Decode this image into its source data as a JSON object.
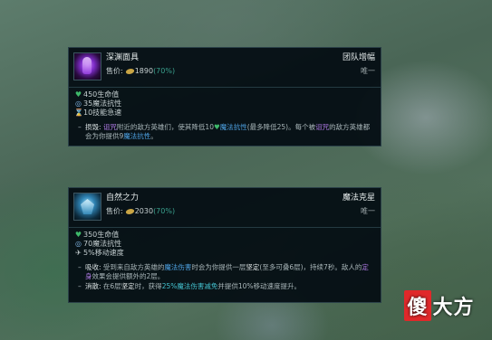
{
  "watermark": {
    "first": "傻",
    "rest": "大方"
  },
  "items": [
    {
      "name": "深渊面具",
      "category": "团队增幅",
      "price_label": "售价:",
      "cost": "1890",
      "sell": "(70%)",
      "unique": "唯一",
      "icon": "abyssal-mask-icon",
      "stats": [
        {
          "icon": "heart-icon",
          "glyph": "♥",
          "text": "450生命值"
        },
        {
          "icon": "magic-resist-icon",
          "glyph": "◎",
          "text": "35魔法抗性"
        },
        {
          "icon": "ability-haste-icon",
          "glyph": "⌛",
          "text": "10技能急速"
        }
      ],
      "passives": [
        {
          "name": "损毁:",
          "parts": [
            {
              "t": " "
            },
            {
              "t": "诅咒",
              "c": "purple"
            },
            {
              "t": "附近的敌方英雄们，使其降低10"
            },
            {
              "t": "♥",
              "c": "heart"
            },
            {
              "t": "魔法抗性",
              "c": "blue"
            },
            {
              "t": "(最多降低25)。每个被"
            },
            {
              "t": "诅咒",
              "c": "purple"
            },
            {
              "t": "的敌方英雄都会为你提供9"
            },
            {
              "t": "魔法抗性",
              "c": "blue"
            },
            {
              "t": "。"
            }
          ]
        }
      ]
    },
    {
      "name": "自然之力",
      "category": "魔法克星",
      "price_label": "售价:",
      "cost": "2030",
      "sell": "(70%)",
      "unique": "唯一",
      "icon": "force-of-nature-icon",
      "stats": [
        {
          "icon": "heart-icon",
          "glyph": "♥",
          "text": "350生命值"
        },
        {
          "icon": "magic-resist-icon",
          "glyph": "◎",
          "text": "70魔法抗性"
        },
        {
          "icon": "move-speed-icon",
          "glyph": "✈",
          "text": "5%移动速度"
        }
      ],
      "passives": [
        {
          "name": "吸收:",
          "parts": [
            {
              "t": " 受到来自敌方英雄的"
            },
            {
              "t": "魔法伤害",
              "c": "blue"
            },
            {
              "t": "时会为你提供一层"
            },
            {
              "t": "坚定",
              "c": "white"
            },
            {
              "t": "(至多可叠6层)，持续7秒。敌人的"
            },
            {
              "t": "定身",
              "c": "purple"
            },
            {
              "t": "效果会提供额外的2层。"
            }
          ]
        },
        {
          "name": "消散:",
          "parts": [
            {
              "t": " 在6层"
            },
            {
              "t": "坚定",
              "c": "white"
            },
            {
              "t": "时，获得"
            },
            {
              "t": "25%魔法伤害减免",
              "c": "cyan"
            },
            {
              "t": "并提供10%移动速度提升。"
            }
          ]
        }
      ]
    }
  ]
}
